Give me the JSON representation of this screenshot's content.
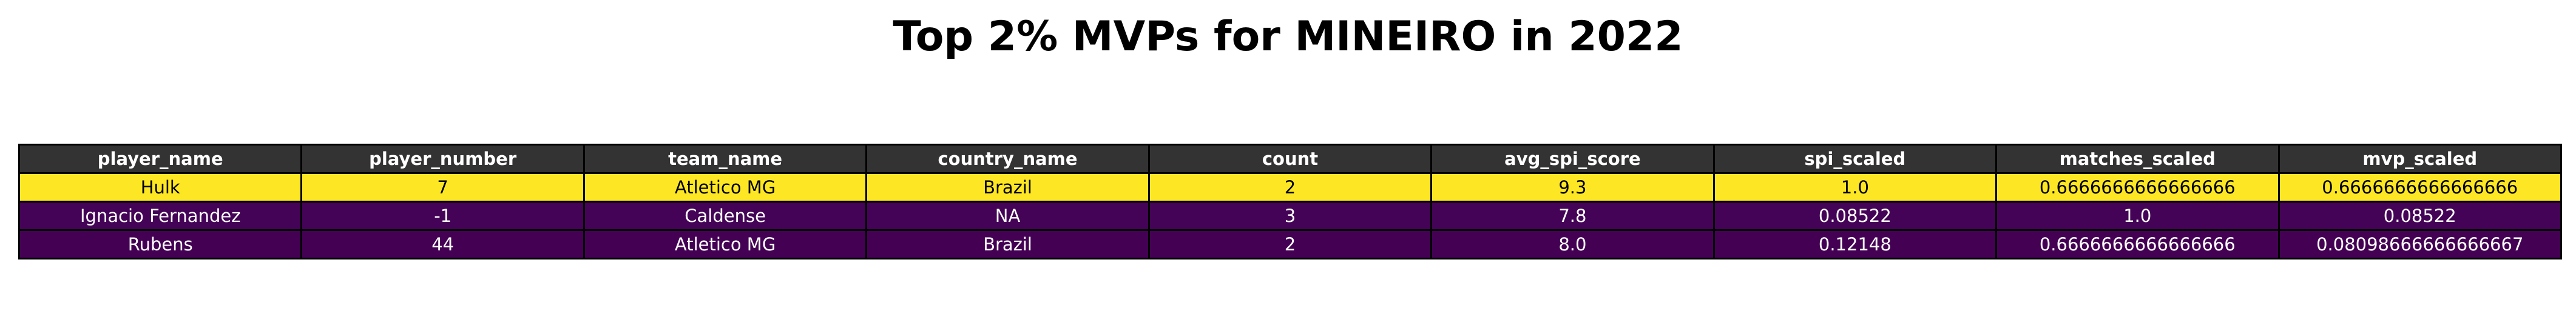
{
  "chart_data": {
    "type": "table",
    "title": "Top 2% MVPs for MINEIRO in 2022",
    "columns": [
      "player_name",
      "player_number",
      "team_name",
      "country_name",
      "count",
      "avg_spi_score",
      "spi_scaled",
      "matches_scaled",
      "mvp_scaled"
    ],
    "rows": [
      [
        "Hulk",
        "7",
        "Atletico MG",
        "Brazil",
        "2",
        "9.3",
        "1.0",
        "0.6666666666666666",
        "0.6666666666666666"
      ],
      [
        "Ignacio Fernandez",
        "-1",
        "Caldense",
        "NA",
        "3",
        "7.8",
        "0.08522",
        "1.0",
        "0.08522"
      ],
      [
        "Rubens",
        "44",
        "Atletico MG",
        "Brazil",
        "2",
        "8.0",
        "0.12148",
        "0.6666666666666666",
        "0.08098666666666667"
      ]
    ],
    "mvp_scaled_values": [
      0.6666666666666666,
      0.08522,
      0.08098666666666667
    ],
    "colors": {
      "header_bg": "#333333",
      "header_text": "#ffffff",
      "colormap": "viridis",
      "viridis_high": "#fde725",
      "viridis_low": "#440154",
      "light_text": "#000000",
      "dark_text": "#ffffff"
    }
  }
}
